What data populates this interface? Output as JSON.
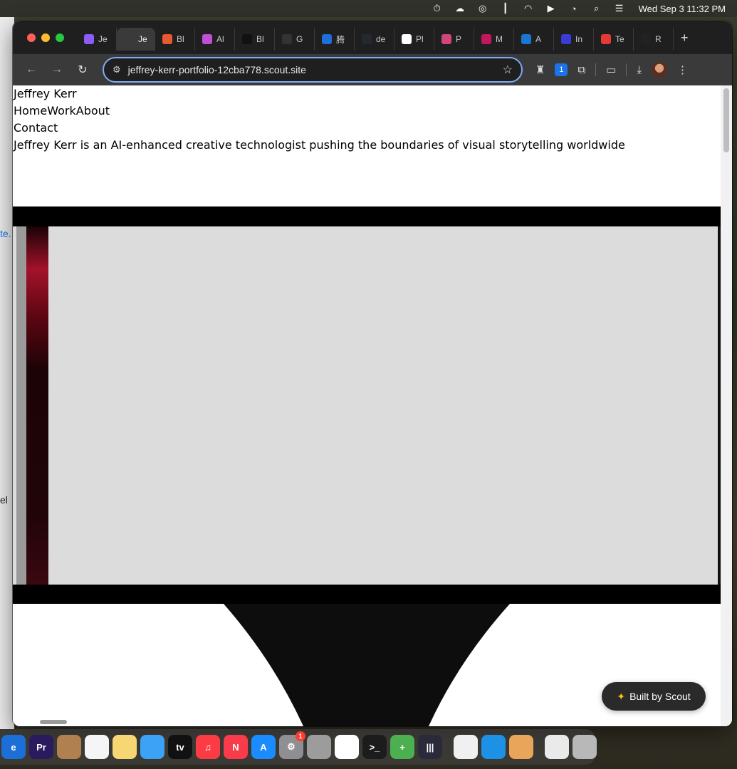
{
  "menubar": {
    "icons": [
      "timer-icon",
      "cloud-icon",
      "creative-cloud-icon",
      "audio-levels-icon",
      "headphones-icon",
      "play-circle-icon",
      "wifi-icon",
      "search-icon",
      "control-center-icon"
    ],
    "clock": "Wed Sep 3  11:32 PM"
  },
  "left_peek": {
    "link_fragment": "te.",
    "text_fragment": "el"
  },
  "tabs": [
    {
      "label": "Je",
      "color": "#8b5cf6",
      "active": false
    },
    {
      "label": "Je",
      "color": "#3a3a3a",
      "active": true
    },
    {
      "label": "Bl",
      "color": "#e8592f",
      "active": false
    },
    {
      "label": "Al",
      "color": "#c14fd6",
      "active": false
    },
    {
      "label": "Bl",
      "color": "#111111",
      "active": false
    },
    {
      "label": "G",
      "color": "#333333",
      "active": false
    },
    {
      "label": "腾",
      "color": "#1e6fd9",
      "active": false
    },
    {
      "label": "de",
      "color": "#24292f",
      "active": false
    },
    {
      "label": "Pl",
      "color": "#ffffff",
      "active": false
    },
    {
      "label": "P",
      "color": "#d1457a",
      "active": false
    },
    {
      "label": "M",
      "color": "#c2185b",
      "active": false
    },
    {
      "label": "A",
      "color": "#1976d2",
      "active": false
    },
    {
      "label": "In",
      "color": "#3b3bd6",
      "active": false
    },
    {
      "label": "Te",
      "color": "#e53935",
      "active": false
    },
    {
      "label": "R",
      "color": "#222222",
      "active": false
    }
  ],
  "tab_close": "×",
  "new_tab": "+",
  "toolbar": {
    "url": "jeffrey-kerr-portfolio-12cba778.scout.site",
    "extension_badge": "1"
  },
  "site": {
    "name": "Jeffrey Kerr",
    "nav": "HomeWorkAbout",
    "contact": "Contact",
    "tagline": "Jeffrey Kerr is an AI-enhanced creative technologist pushing the boundaries of visual storytelling worldwide"
  },
  "scout_badge": {
    "icon": "sparkles-icon",
    "label": "Built by Scout"
  },
  "dock": {
    "notification_count": "1",
    "apps": [
      {
        "name": "edge-partial",
        "label": "e",
        "color": "#1d6fd8"
      },
      {
        "name": "premiere",
        "label": "Pr",
        "color": "#2a1a5e"
      },
      {
        "name": "contacts",
        "label": "",
        "color": "#b08050"
      },
      {
        "name": "reminders",
        "label": "",
        "color": "#f5f5f5"
      },
      {
        "name": "notes",
        "label": "",
        "color": "#f7d774"
      },
      {
        "name": "freeform",
        "label": "",
        "color": "#3ba2f5"
      },
      {
        "name": "apple-tv",
        "label": "tv",
        "color": "#111111"
      },
      {
        "name": "music",
        "label": "♫",
        "color": "#fc3c44"
      },
      {
        "name": "news",
        "label": "N",
        "color": "#fa3b4c"
      },
      {
        "name": "app-store",
        "label": "A",
        "color": "#1a8cff"
      },
      {
        "name": "system-settings",
        "label": "⚙",
        "color": "#8e8e93"
      },
      {
        "name": "iphone-mirroring",
        "label": "",
        "color": "#9c9c9c"
      },
      {
        "name": "chrome",
        "label": "",
        "color": "#ffffff"
      },
      {
        "name": "terminal",
        "label": ">_",
        "color": "#1c1c1c"
      },
      {
        "name": "cloud-app",
        "label": "+",
        "color": "#4caf50"
      },
      {
        "name": "audio-app",
        "label": "|||",
        "color": "#2a2a3a"
      },
      {
        "name": "textedit",
        "label": "",
        "color": "#f0f0f0"
      },
      {
        "name": "docker",
        "label": "",
        "color": "#1d91e6"
      },
      {
        "name": "archive-utility",
        "label": "",
        "color": "#e9a55a"
      },
      {
        "name": "zip-file",
        "label": "",
        "color": "#eaeaea"
      },
      {
        "name": "trash",
        "label": "",
        "color": "#b8b8b8"
      }
    ]
  }
}
